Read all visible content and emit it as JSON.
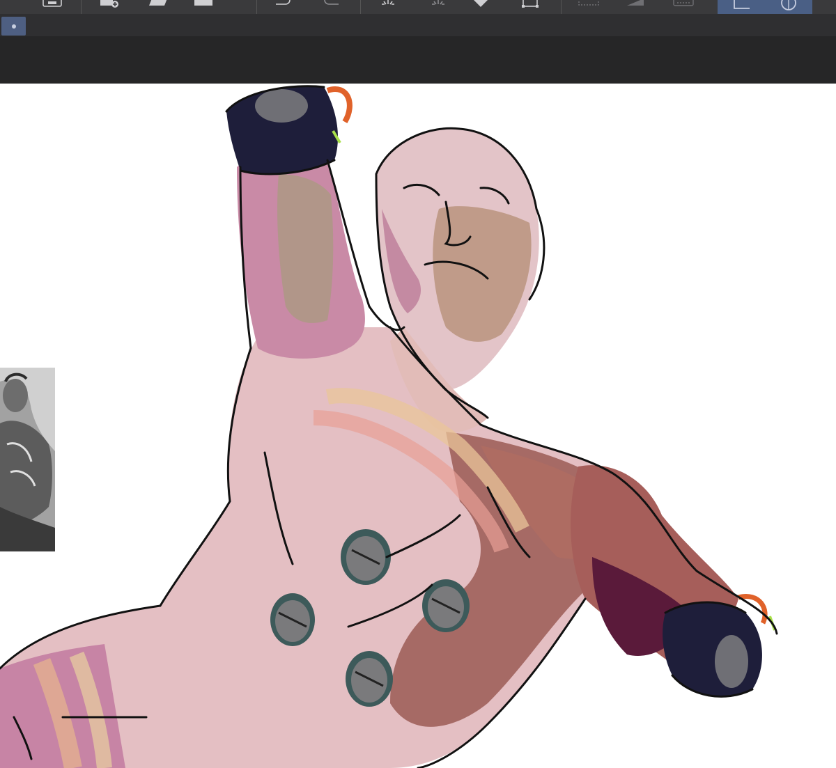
{
  "app": {
    "accent": "#4a5f85",
    "toolbar_bg": "#3a3a3c",
    "canvas_bg": "#ffffff"
  },
  "toolbar": {
    "tools": [
      {
        "icon": "export-icon"
      },
      {
        "icon": "add-layer-icon"
      },
      {
        "icon": "eraser-icon"
      },
      {
        "icon": "rectangle-select-icon"
      },
      {
        "icon": "undo-icon"
      },
      {
        "icon": "redo-icon"
      },
      {
        "icon": "brush-sparkle-icon"
      },
      {
        "icon": "clear-sparkle-icon"
      },
      {
        "icon": "fill-icon"
      },
      {
        "icon": "transform-icon"
      },
      {
        "icon": "deselect-icon"
      },
      {
        "icon": "invert-select-icon"
      },
      {
        "icon": "keyboard-icon"
      },
      {
        "icon": "ruler-icon"
      },
      {
        "icon": "symmetry-icon"
      }
    ]
  },
  "canvas": {
    "artwork": "digital-figure-painting",
    "reference": "statue-reference-photo"
  }
}
